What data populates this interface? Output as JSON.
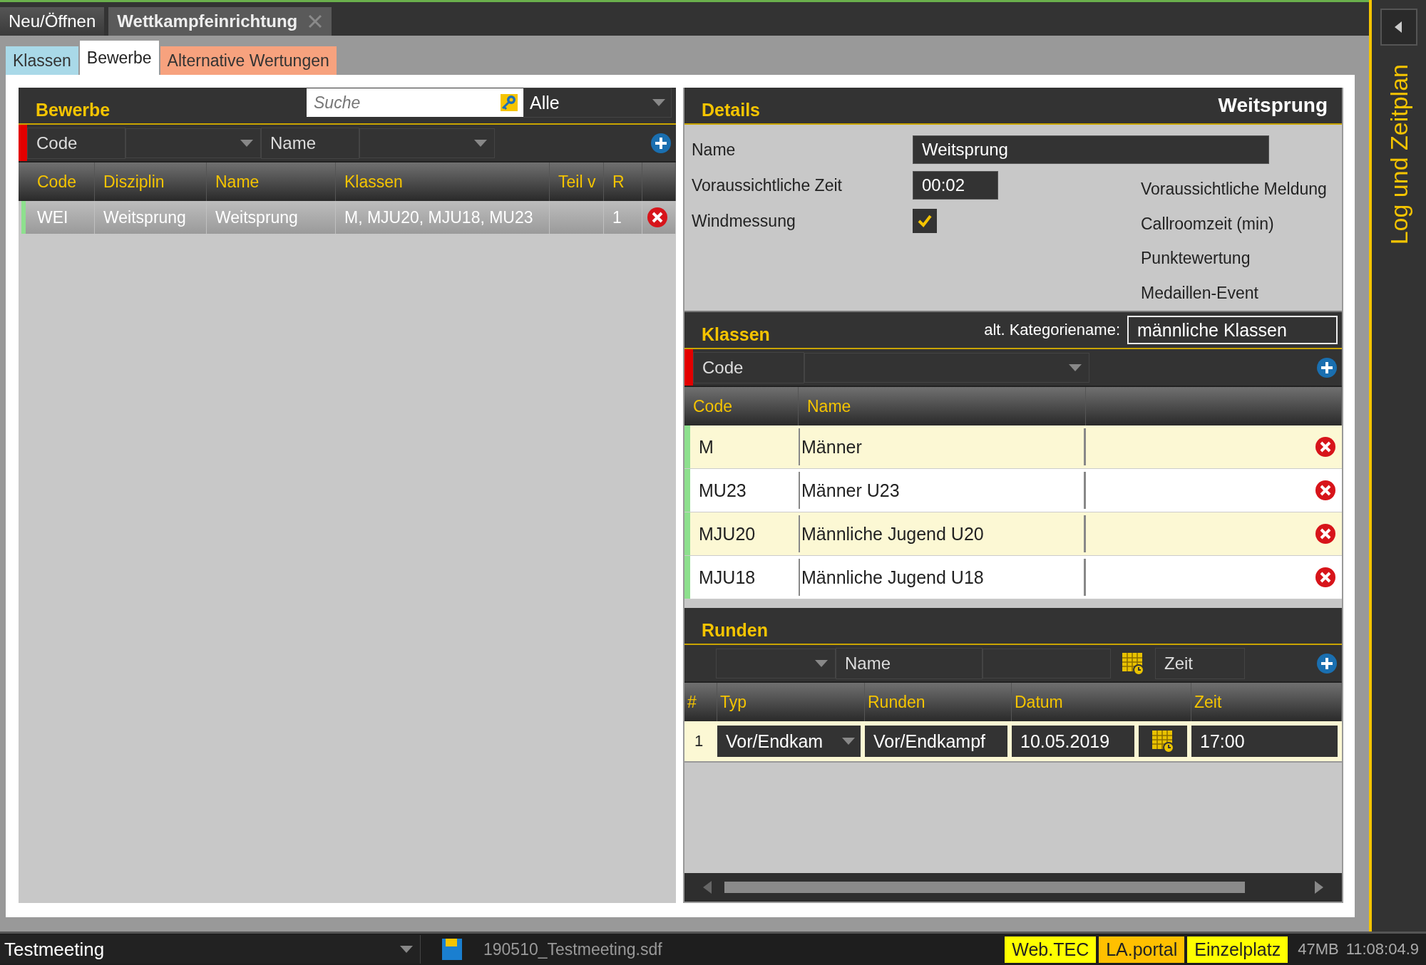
{
  "top_tabs": [
    {
      "label": "Neu/Öffnen",
      "selected": false,
      "closable": false
    },
    {
      "label": "Wettkampfeinrichtung",
      "selected": true,
      "closable": true
    }
  ],
  "sub_tabs": [
    {
      "label": "Klassen",
      "color": "#a9d9e8",
      "selected": false
    },
    {
      "label": "Bewerbe",
      "color": "#ffffff",
      "selected": true
    },
    {
      "label": "Alternative Wertungen",
      "color": "#f7a27e",
      "selected": false
    }
  ],
  "bewerbe": {
    "title": "Bewerbe",
    "search": {
      "placeholder": "Suche"
    },
    "filter": "Alle",
    "filter_fields": [
      "Code",
      "Name"
    ],
    "columns": [
      "Code",
      "Disziplin",
      "Name",
      "Klassen",
      "Teil v",
      "R"
    ],
    "rows": [
      {
        "code": "WEI",
        "disziplin": "Weitsprung",
        "name": "Weitsprung",
        "klassen": "M, MJU20, MJU18, MU23",
        "r": "1",
        "selected": true
      }
    ]
  },
  "details": {
    "title": "Details",
    "heading": "Weitsprung",
    "fields": [
      {
        "kind": "text",
        "label": "Name",
        "value": "Weitsprung"
      },
      {
        "kind": "time",
        "label": "Voraussichtliche Zeit",
        "value": "00:02"
      },
      {
        "kind": "checkbox",
        "label": "Windmessung",
        "checked": true
      }
    ],
    "right_labels": [
      "Voraussichtliche Meldung",
      "Callroomzeit (min)",
      "Punktewertung",
      "Medaillen-Event"
    ]
  },
  "klassen": {
    "title": "Klassen",
    "alt_label": "alt. Kategoriename:",
    "alt_value": "männliche Klassen",
    "filter_field": "Code",
    "columns": [
      "Code",
      "Name"
    ],
    "rows": [
      {
        "code": "M",
        "name": "Männer"
      },
      {
        "code": "MU23",
        "name": "Männer U23"
      },
      {
        "code": "MJU20",
        "name": "Männliche Jugend U20"
      },
      {
        "code": "MJU18",
        "name": "Männliche Jugend U18"
      }
    ]
  },
  "runden": {
    "title": "Runden",
    "filter_fields": [
      "Name",
      "Zeit"
    ],
    "columns": [
      "#",
      "Typ",
      "Runden",
      "Datum",
      "Zeit"
    ],
    "rows": [
      {
        "index": "1",
        "typ": "Vor/Endkam",
        "runden": "Vor/Endkampf",
        "datum": "10.05.2019",
        "zeit": "17:00"
      }
    ]
  },
  "side_panel": {
    "title": "Log und Zeitplan"
  },
  "status_bar": {
    "meeting": "Testmeeting",
    "file": "190510_Testmeeting.sdf",
    "badges": [
      {
        "label": "Web.TEC",
        "color": "#ffff00"
      },
      {
        "label": "LA.portal",
        "color": "#ffc000"
      },
      {
        "label": "Einzelplatz",
        "color": "#ffff00"
      }
    ],
    "memory": "47MB",
    "time": "11:08:04.9"
  }
}
